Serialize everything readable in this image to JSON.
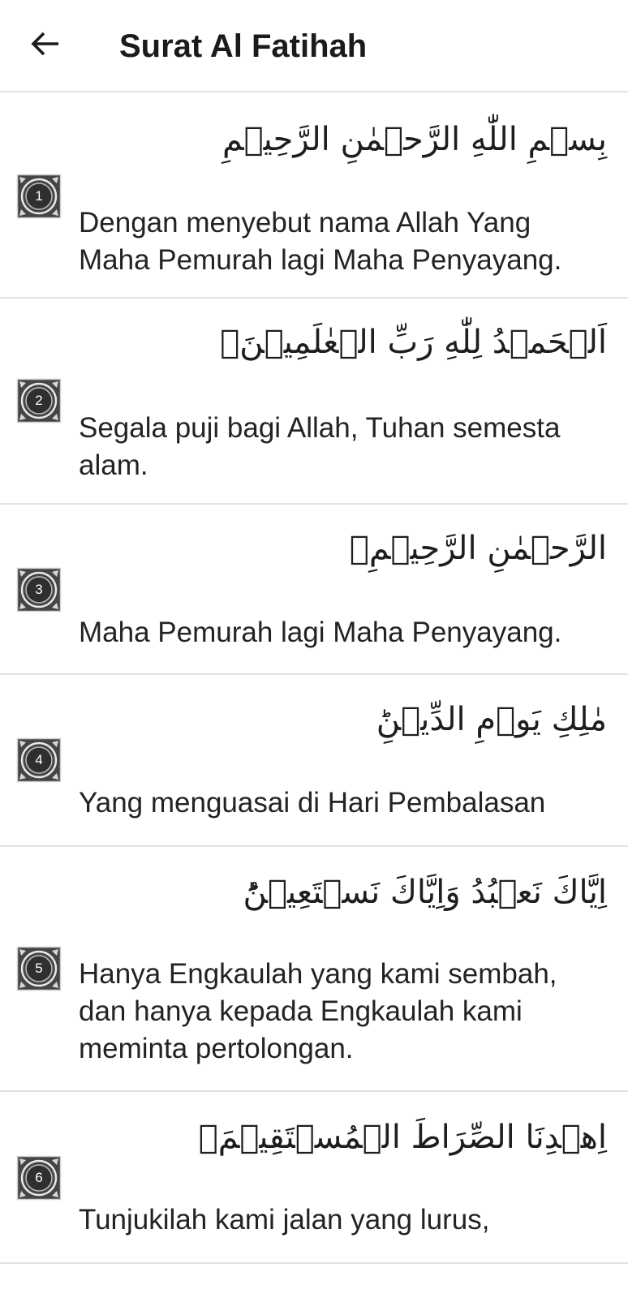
{
  "app_bar": {
    "title": "Surat Al Fatihah",
    "back_icon": "arrow-left-icon"
  },
  "colors": {
    "badge_fill": "#454545",
    "divider": "#e2e2e2",
    "text": "#212121"
  },
  "verses": [
    {
      "number": "1",
      "arabic": "بِسۡمِ اللّٰهِ الرَّحۡمٰنِ الرَّحِيۡمِ",
      "translation": "Dengan menyebut nama Allah Yang Maha Pemurah lagi Maha Penyayang."
    },
    {
      "number": "2",
      "arabic": "اَلۡحَمۡدُ لِلّٰهِ رَبِّ الۡعٰلَمِيۡنَۙ",
      "translation": "Segala puji bagi Allah, Tuhan semesta alam."
    },
    {
      "number": "3",
      "arabic": "الرَّحۡمٰنِ الرَّحِيۡمِۙ",
      "translation": "Maha Pemurah lagi Maha Penyayang."
    },
    {
      "number": "4",
      "arabic": "مٰلِكِ يَوۡمِ الدِّيۡنِؕ",
      "translation": "Yang menguasai di Hari Pembalasan"
    },
    {
      "number": "5",
      "arabic": "اِيَّاكَ نَعۡبُدُ وَاِيَّاكَ نَسۡتَعِيۡنُؕ",
      "translation": "Hanya Engkaulah yang kami sembah, dan hanya kepada Engkaulah kami meminta pertolongan."
    },
    {
      "number": "6",
      "arabic": "اِهۡدِنَا الصِّرَاطَ الۡمُسۡتَقِيۡمَۙ",
      "translation": "Tunjukilah kami jalan yang lurus,"
    }
  ]
}
